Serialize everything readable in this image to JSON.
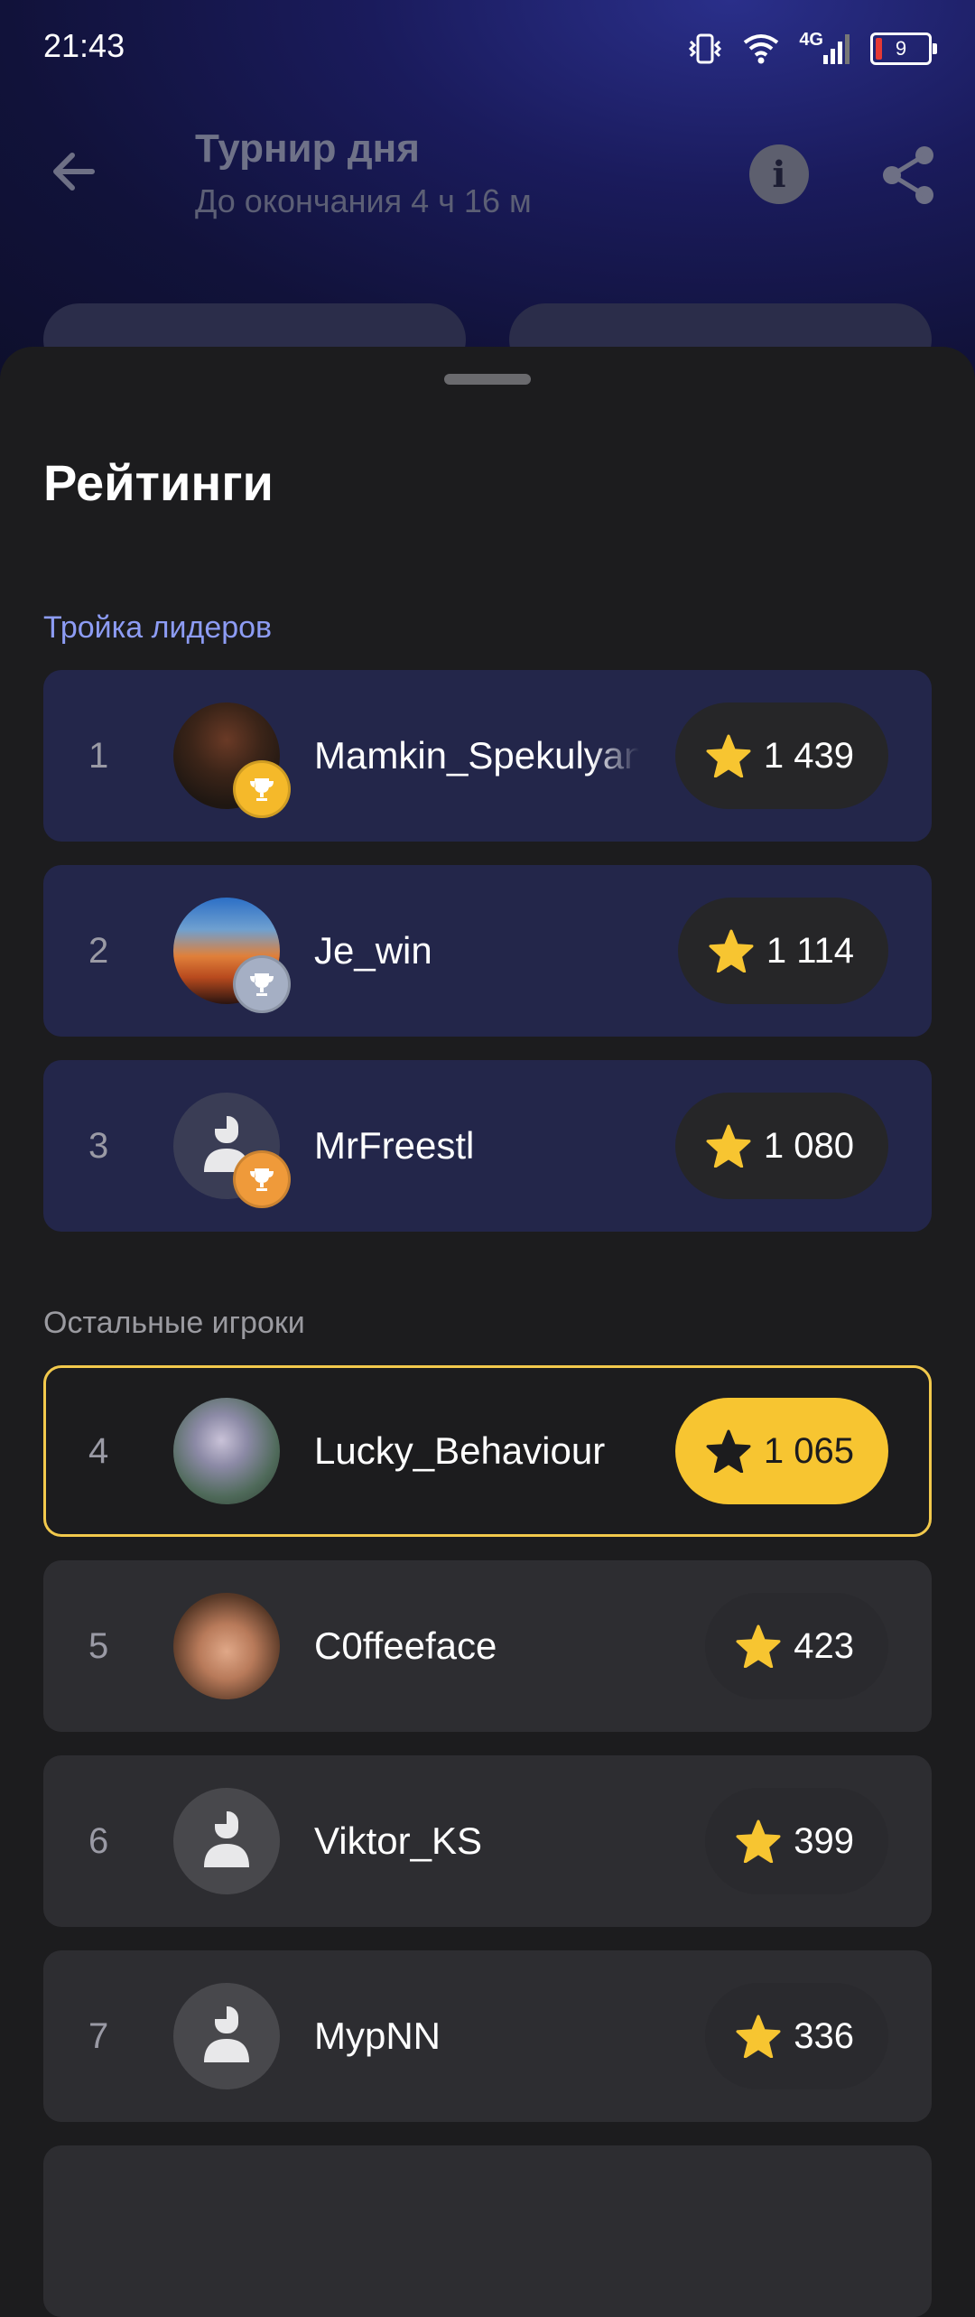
{
  "status": {
    "time": "21:43",
    "network": "4G",
    "battery": "9"
  },
  "header": {
    "title": "Турнир дня",
    "subtitle": "До окончания 4 ч 16 м"
  },
  "sheet": {
    "title": "Рейтинги",
    "top_label": "Тройка лидеров",
    "rest_label": "Остальные игроки"
  },
  "players": [
    {
      "rank": "1",
      "name": "Mamkin_Spekulyant",
      "score": "1 439",
      "trophy": "gold",
      "avatar": "photo"
    },
    {
      "rank": "2",
      "name": "Je_win",
      "score": "1 114",
      "trophy": "silver",
      "avatar": "photo"
    },
    {
      "rank": "3",
      "name": "MrFreestl",
      "score": "1 080",
      "trophy": "bronze",
      "avatar": "default"
    },
    {
      "rank": "4",
      "name": "Lucky_Behaviour",
      "score": "1 065",
      "highlight": true,
      "avatar": "photo"
    },
    {
      "rank": "5",
      "name": "C0ffeeface",
      "score": "423",
      "avatar": "photo"
    },
    {
      "rank": "6",
      "name": "Viktor_KS",
      "score": "399",
      "avatar": "default"
    },
    {
      "rank": "7",
      "name": "MypNN",
      "score": "336",
      "avatar": "default"
    }
  ],
  "colors": {
    "accent": "#f7c531",
    "top_row": "#23264a",
    "row": "#2d2d31",
    "section_accent": "#8d9cf4"
  },
  "icons": [
    "back-arrow-icon",
    "info-icon",
    "share-icon",
    "star-icon",
    "trophy-icon",
    "default-avatar-icon"
  ]
}
